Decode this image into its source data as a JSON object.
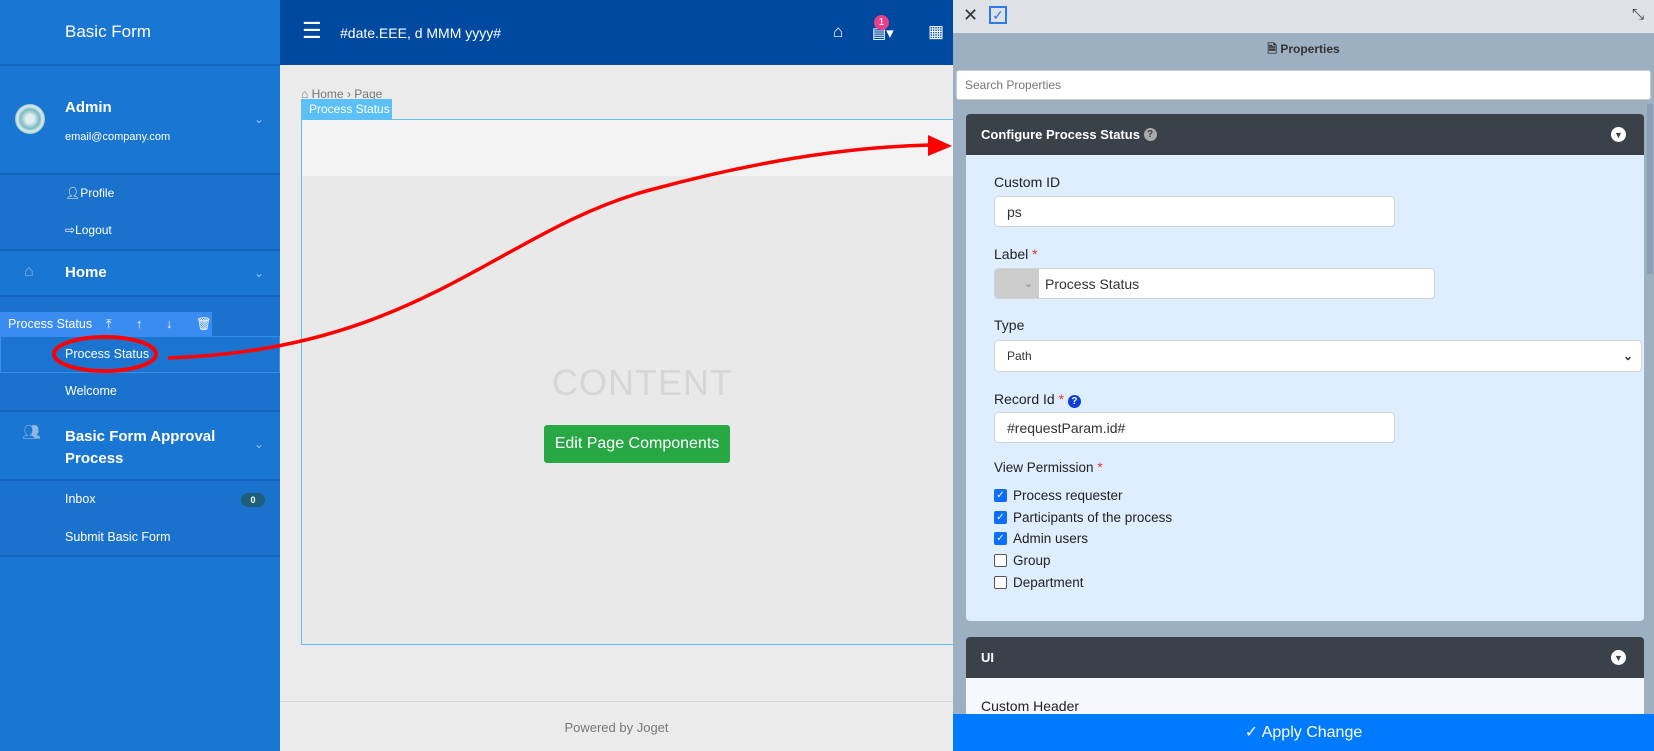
{
  "sidebar": {
    "brand": "Basic Form",
    "user": {
      "name": "Admin",
      "email": "email@company.com"
    },
    "user_links": [
      {
        "label": "Profile",
        "icon": "user-icon"
      },
      {
        "label": "Logout",
        "icon": "logout-icon"
      }
    ],
    "home": {
      "label": "Home",
      "icon": "home-icon"
    },
    "selected_toolbar": {
      "label": "Process Status",
      "icons": [
        "move-top-icon",
        "arrow-up-icon",
        "arrow-down-icon",
        "trash-icon"
      ]
    },
    "home_items": [
      {
        "label": "Process Status"
      },
      {
        "label": "Welcome"
      }
    ],
    "process": {
      "label_line1": "Basic Form Approval",
      "label_line2": "Process",
      "icon": "users-icon"
    },
    "process_items": [
      {
        "label": "Inbox",
        "badge": "0"
      },
      {
        "label": "Submit Basic Form"
      }
    ]
  },
  "header": {
    "date": "#date.EEE, d MMM yyyy#",
    "notification_count": "1"
  },
  "main": {
    "breadcrumb": {
      "home": "Home",
      "sep": "›",
      "page": "Page"
    },
    "element_tab": "Process Status",
    "placeholder": "CONTENT",
    "edit_button": "Edit Page Components",
    "footer": "Powered by Joget"
  },
  "panel": {
    "title": "Properties",
    "search_placeholder": "Search Properties",
    "section1": {
      "title": "Configure Process Status",
      "custom_id_label": "Custom ID",
      "custom_id_value": "ps",
      "label_label": "Label",
      "label_value": "Process Status",
      "type_label": "Type",
      "type_value": "Path",
      "record_id_label": "Record Id",
      "record_id_value": "#requestParam.id#",
      "view_permission_label": "View Permission",
      "permissions": [
        {
          "label": "Process requester",
          "checked": true
        },
        {
          "label": "Participants of the process",
          "checked": true
        },
        {
          "label": "Admin users",
          "checked": true
        },
        {
          "label": "Group",
          "checked": false
        },
        {
          "label": "Department",
          "checked": false
        }
      ]
    },
    "section2": {
      "title": "UI",
      "first_field": "Custom Header"
    },
    "apply_button": "Apply Change"
  },
  "colors": {
    "sidebar": "#1976d2",
    "header": "#0049a0",
    "apply": "#007bff",
    "edit_button": "#28a745",
    "annotation": "#ff0000"
  }
}
